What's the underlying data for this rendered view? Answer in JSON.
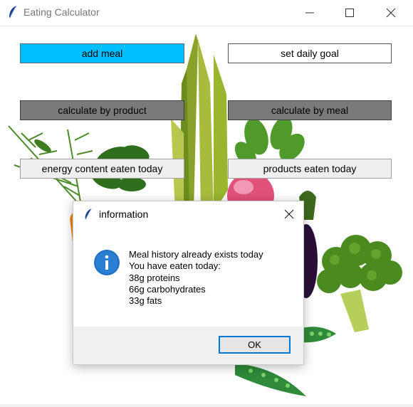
{
  "window": {
    "title": "Eating Calculator",
    "icons": {
      "app": "feather-icon",
      "minimize": "minimize-icon",
      "maximize": "maximize-icon",
      "close": "close-icon"
    }
  },
  "buttons": {
    "add_meal": "add meal",
    "set_daily_goal": "set daily goal",
    "calculate_by_product": "calculate by product",
    "calculate_by_meal": "calculate by meal",
    "energy_content_eaten_today": "energy content eaten today",
    "products_eaten_today": "products eaten today"
  },
  "colors": {
    "accent_button": "#00bfff",
    "disabled_button": "#7a7a7a",
    "ok_focus_border": "#0078d7"
  },
  "dialog": {
    "title": "information",
    "icon": "info-icon",
    "message_lines": [
      "Meal history already exists today",
      "You have eaten today:",
      "38g proteins",
      "66g carbohydrates",
      "33g fats"
    ],
    "ok_label": "OK"
  }
}
